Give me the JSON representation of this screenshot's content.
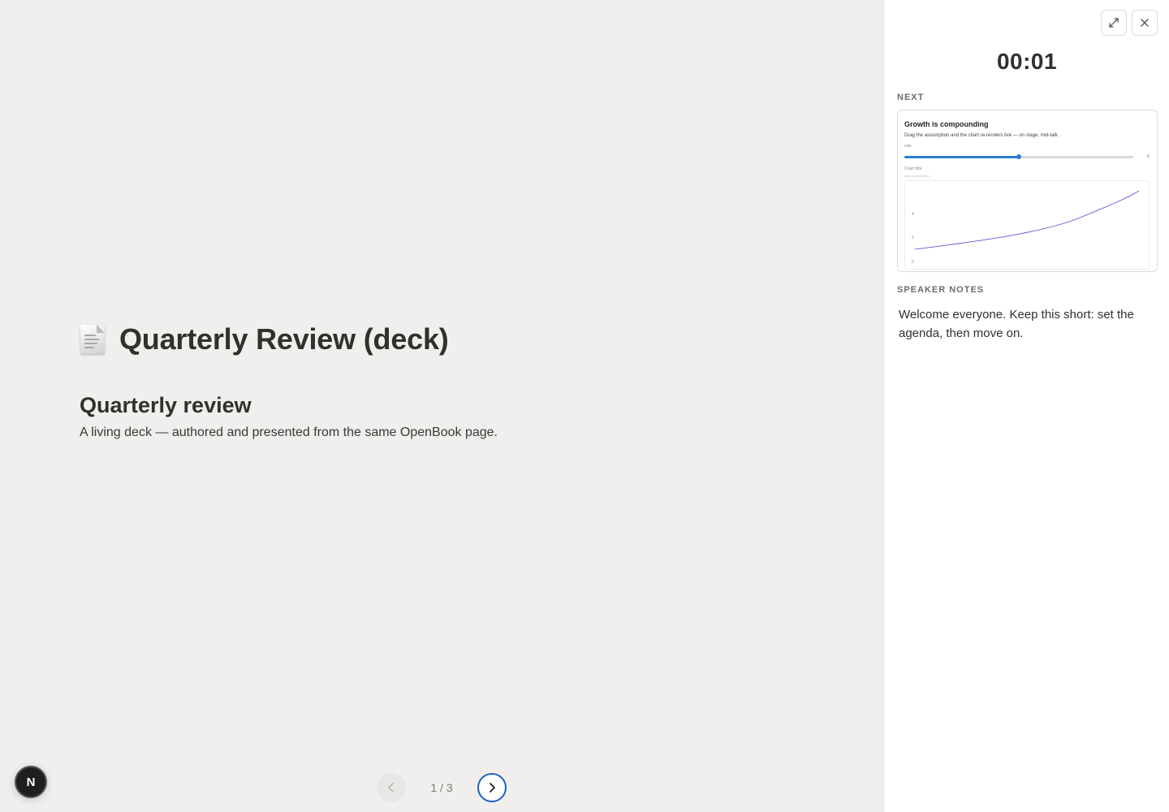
{
  "slide": {
    "doc_icon": "document-icon",
    "deck_title": "Quarterly Review (deck)",
    "heading": "Quarterly review",
    "subtitle": "A living deck — authored and presented from the same OpenBook page."
  },
  "nav": {
    "prev_icon": "chevron-left-icon",
    "next_icon": "chevron-right-icon",
    "page_indicator": "1 / 3"
  },
  "badge": {
    "label": "N"
  },
  "panel": {
    "expand_icon": "expand-icon",
    "close_icon": "close-icon",
    "timer": "00:01",
    "next_label": "NEXT",
    "next_preview": {
      "title": "Growth is compounding",
      "subtitle": "Drag the assumption and the chart re-renders live — on stage, mid-talk.",
      "slider_label": "rate",
      "slider_value": "8",
      "slider_fraction": 0.5,
      "chart_title_label": "Chart title",
      "chart_desc_placeholder": "Add a description...",
      "y_ticks": [
        "0",
        "2",
        "4"
      ]
    },
    "notes_label": "SPEAKER NOTES",
    "notes": "Welcome everyone. Keep this short: set the agenda, then move on."
  },
  "colors": {
    "accent": "#1c5fc1",
    "slider": "#2a7fd4",
    "line": "#5b5bd6"
  }
}
